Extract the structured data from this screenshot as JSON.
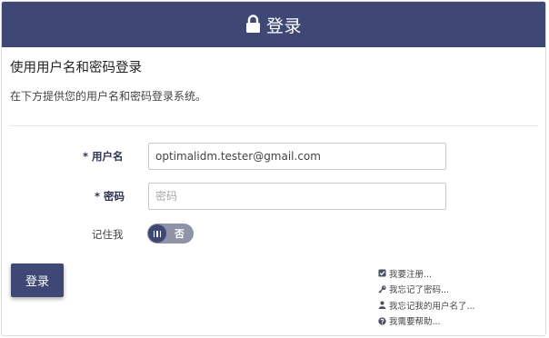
{
  "header": {
    "title": "登录",
    "icon": "lock-icon",
    "background": "#3f4874"
  },
  "intro": {
    "heading": "使用用户名和密码登录",
    "text": "在下方提供您的用户名和密码登录系统。"
  },
  "form": {
    "username": {
      "required_mark": "*",
      "label": "用户名",
      "value": "optimalidm.tester@gmail.com"
    },
    "password": {
      "required_mark": "*",
      "label": "密码",
      "placeholder": "密码",
      "value": ""
    },
    "remember": {
      "label": "记住我",
      "toggle_text": "否",
      "state": "off"
    }
  },
  "actions": {
    "login_label": "登录"
  },
  "links": [
    {
      "icon": "checkbox-icon",
      "label": "我要注册..."
    },
    {
      "icon": "key-icon",
      "label": "我忘记了密码..."
    },
    {
      "icon": "user-icon",
      "label": "我忘记我的用户名了..."
    },
    {
      "icon": "question-circle-icon",
      "label": "我需要帮助..."
    }
  ],
  "colors": {
    "accent": "#3f4874",
    "toggle_track": "#8e93a6"
  }
}
